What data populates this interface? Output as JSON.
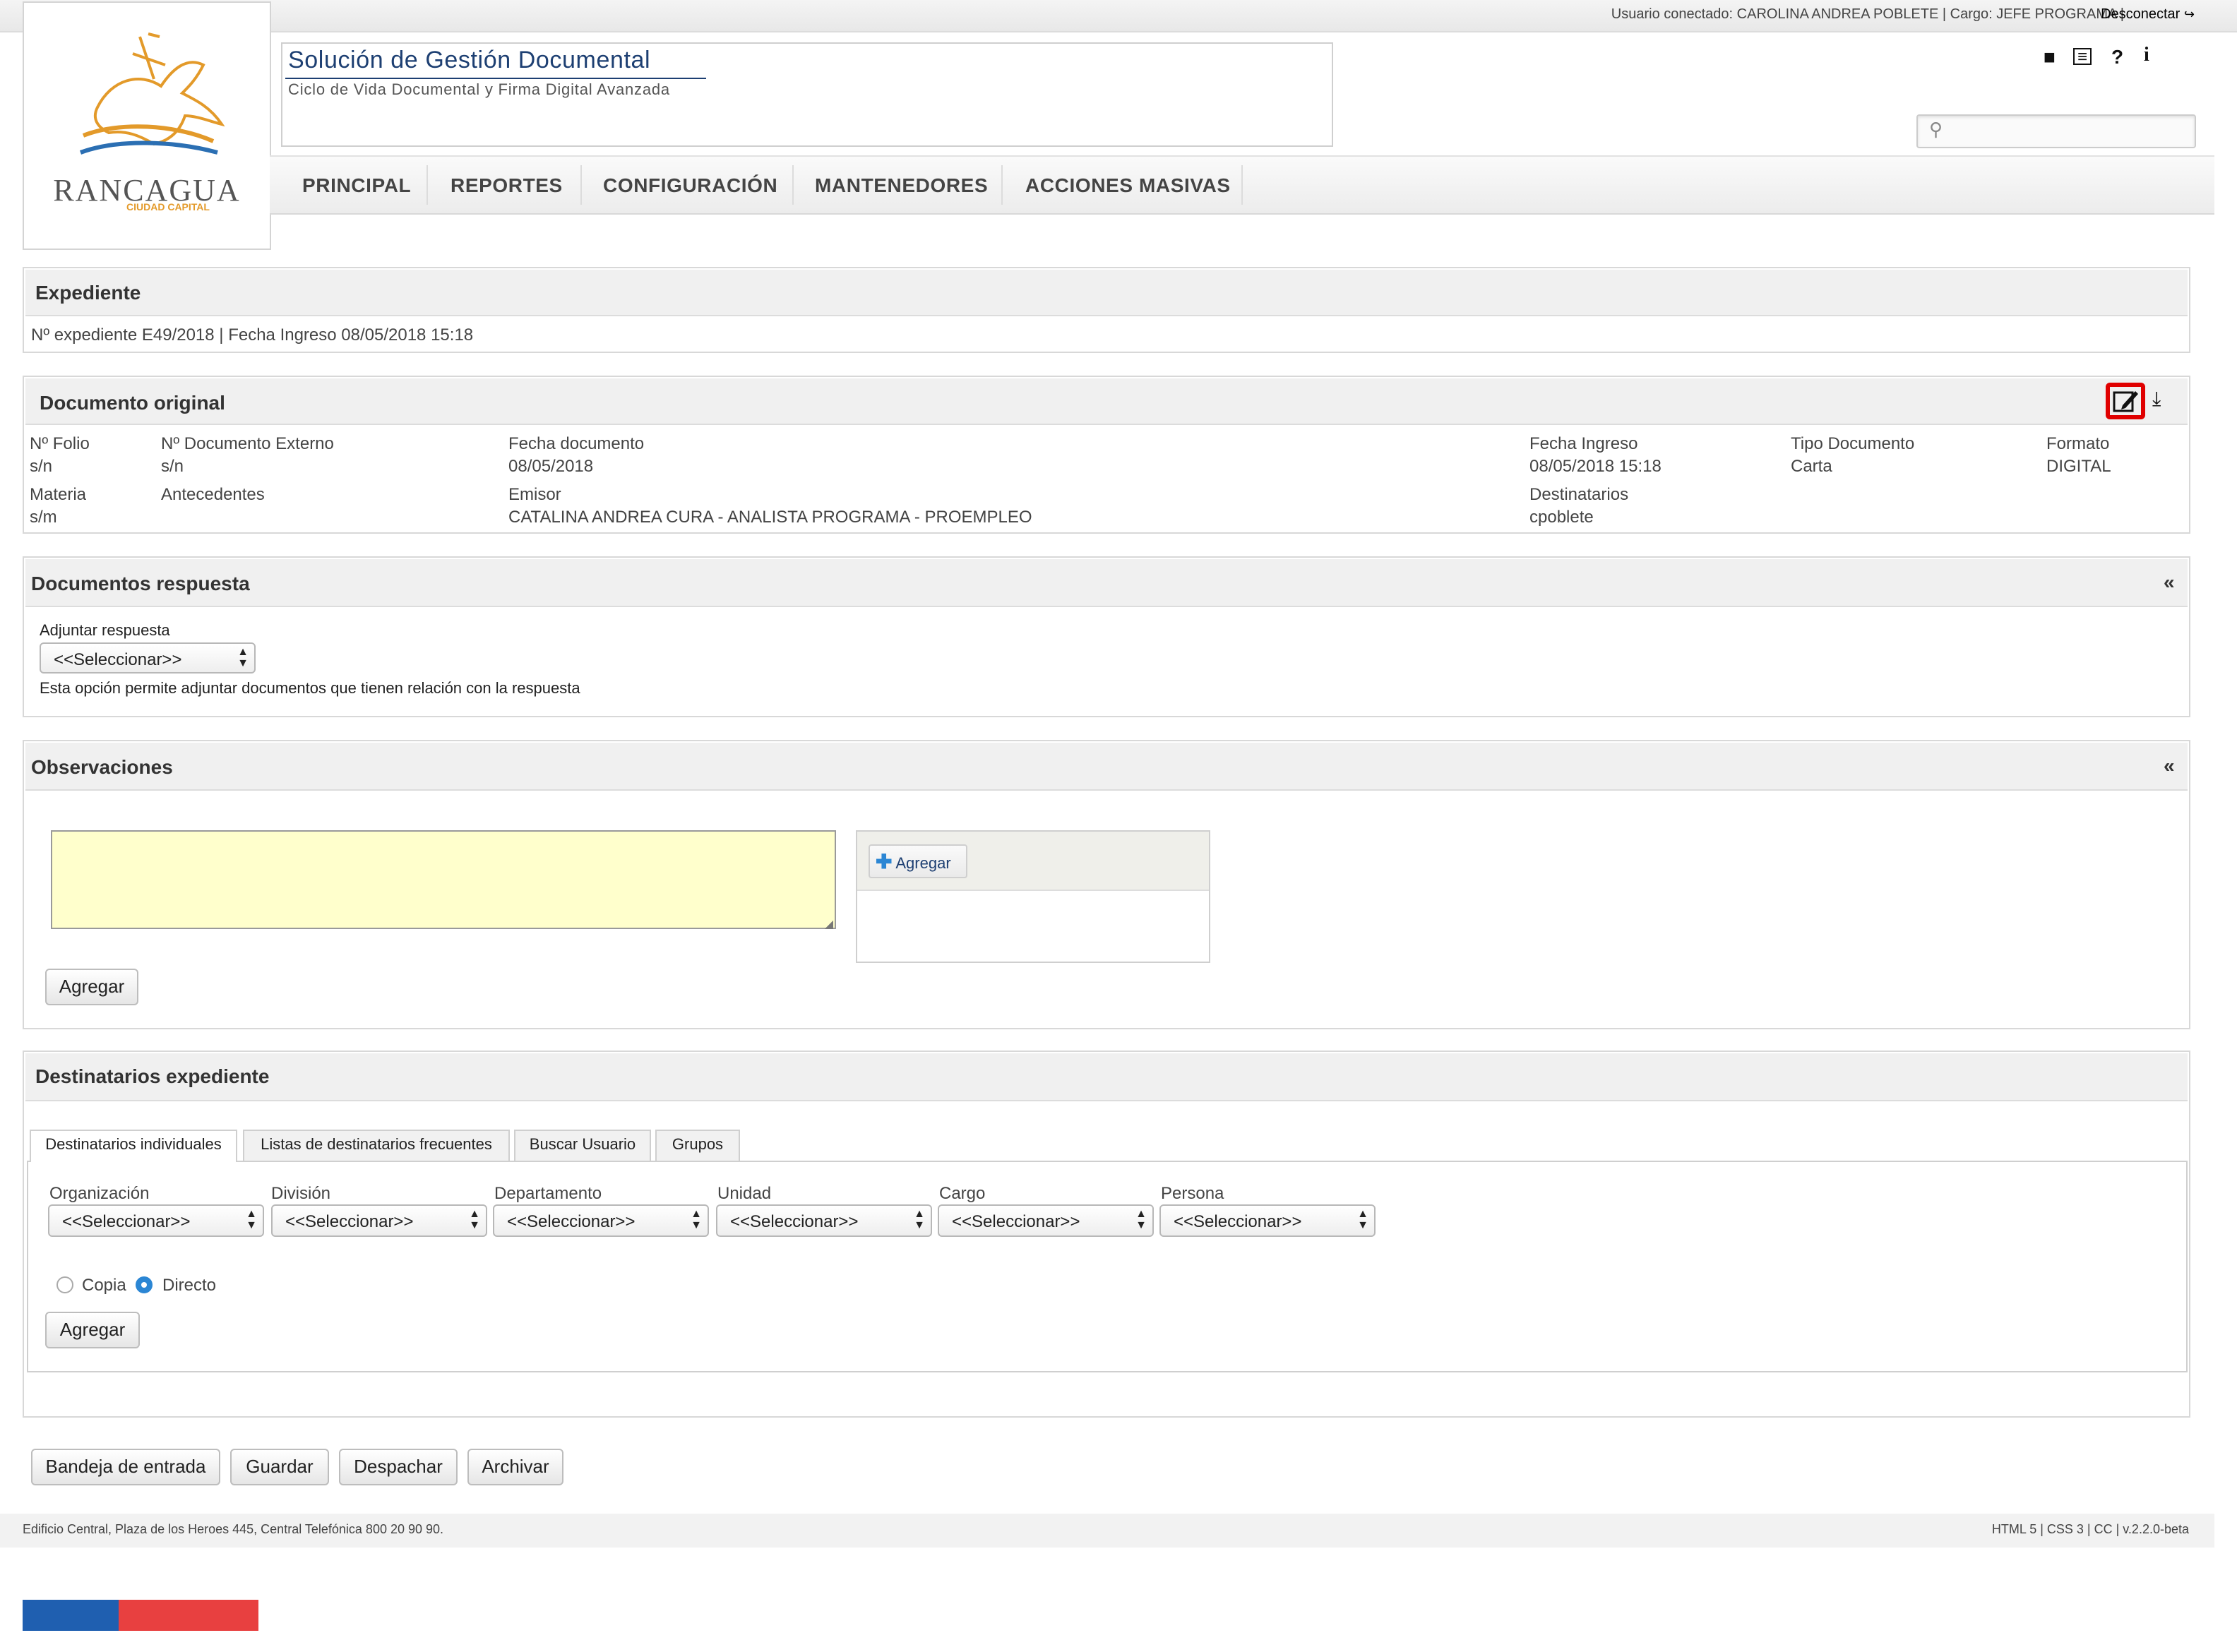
{
  "topbar": {
    "user_info": "Usuario conectado: CAROLINA ANDREA POBLETE | Cargo: JEFE PROGRAMA |",
    "logout": "Desconectar"
  },
  "logo": {
    "name": "RANCAGUA",
    "tagline": "CIUDAD CAPITAL"
  },
  "header": {
    "title": "Solución de Gestión Documental",
    "subtitle": "Ciclo de Vida Documental y Firma Digital Avanzada"
  },
  "nav": [
    "PRINCIPAL",
    "REPORTES",
    "CONFIGURACIÓN",
    "MANTENEDORES",
    "ACCIONES MASIVAS"
  ],
  "expediente": {
    "title": "Expediente",
    "info": "Nº expediente  E49/2018  |  Fecha Ingreso 08/05/2018 15:18"
  },
  "documento": {
    "title": "Documento original",
    "fields": [
      {
        "label": "Nº Folio",
        "value": "s/n"
      },
      {
        "label": "Nº Documento Externo",
        "value": "s/n"
      },
      {
        "label": "Fecha documento",
        "value": "08/05/2018"
      },
      {
        "label": "Fecha Ingreso",
        "value": "08/05/2018 15:18"
      },
      {
        "label": "Tipo Documento",
        "value": "Carta"
      },
      {
        "label": "Formato",
        "value": "DIGITAL"
      },
      {
        "label": "Materia",
        "value": "s/m"
      },
      {
        "label": "Antecedentes",
        "value": ""
      },
      {
        "label": "Emisor",
        "value": "CATALINA ANDREA CURA - ANALISTA PROGRAMA - PROEMPLEO"
      },
      {
        "label": "Destinatarios",
        "value": "cpoblete"
      }
    ]
  },
  "respuesta": {
    "title": "Documentos respuesta",
    "collapse": "«",
    "attach_label": "Adjuntar respuesta",
    "attach_value": "<<Seleccionar>>",
    "hint": "Esta opción permite adjuntar documentos que tienen relación con la respuesta"
  },
  "observaciones": {
    "title": "Observaciones",
    "collapse": "«",
    "text_value": "",
    "upload_button": "Agregar",
    "add_button": "Agregar"
  },
  "destinatarios": {
    "title": "Destinatarios expediente",
    "tabs": [
      "Destinatarios individuales",
      "Listas de destinatarios frecuentes",
      "Buscar Usuario",
      "Grupos"
    ],
    "filters": [
      {
        "label": "Organización",
        "value": "<<Seleccionar>>"
      },
      {
        "label": "División",
        "value": "<<Seleccionar>>"
      },
      {
        "label": "Departamento",
        "value": "<<Seleccionar>>"
      },
      {
        "label": "Unidad",
        "value": "<<Seleccionar>>"
      },
      {
        "label": "Cargo",
        "value": "<<Seleccionar>>"
      },
      {
        "label": "Persona",
        "value": "<<Seleccionar>>"
      }
    ],
    "radio_copia": "Copia",
    "radio_directo": "Directo",
    "selected": "Directo",
    "add_button": "Agregar"
  },
  "actions": [
    "Bandeja de entrada",
    "Guardar",
    "Despachar",
    "Archivar"
  ],
  "footer": {
    "address": "Edificio Central, Plaza de los Heroes 445, Central Telefónica 800 20 90 90.",
    "version": "HTML 5 | CSS 3 | CC | v.2.2.0-beta"
  },
  "colors": {
    "brand_blue": "#1d3f72",
    "flag_blue": "#1f5fb0",
    "flag_red": "#e84040",
    "textarea_bg": "#ffffcc",
    "highlight": "#e00000"
  }
}
